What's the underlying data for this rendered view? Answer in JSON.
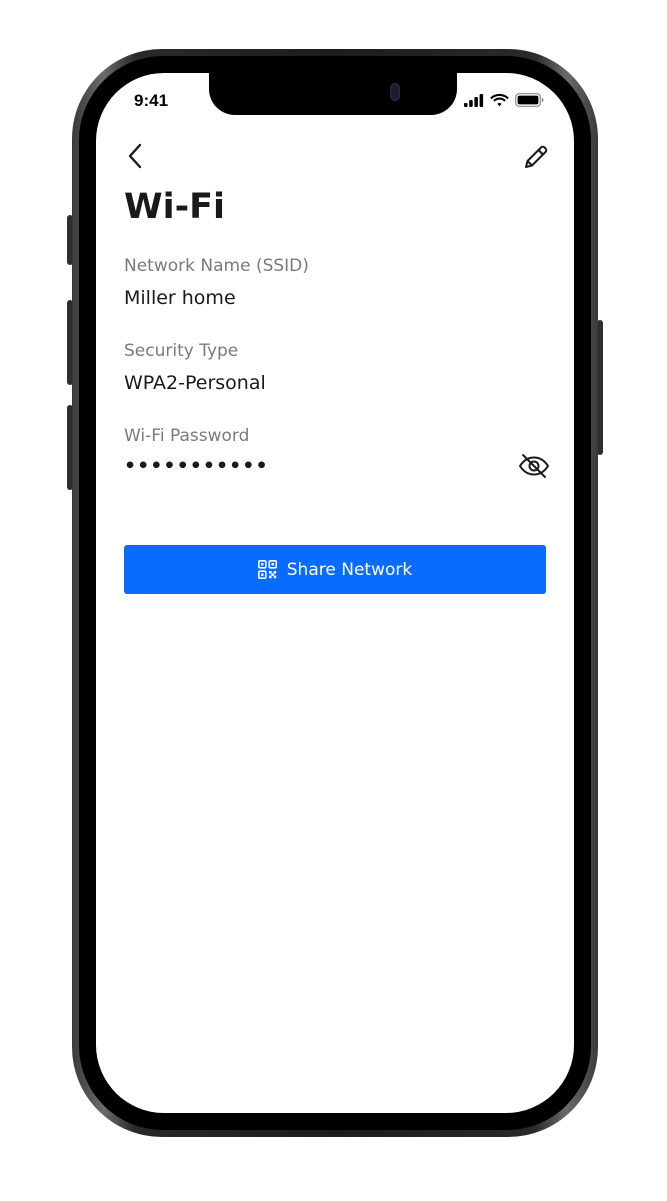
{
  "status_bar": {
    "time": "9:41",
    "icons": [
      "cellular-signal-icon",
      "wifi-icon",
      "battery-icon"
    ]
  },
  "nav": {
    "back_icon": "chevron-left-icon",
    "edit_icon": "pencil-icon"
  },
  "page": {
    "title": "Wi-Fi"
  },
  "fields": {
    "ssid": {
      "label": "Network Name (SSID)",
      "value": "Miller home"
    },
    "security": {
      "label": "Security Type",
      "value": "WPA2-Personal"
    },
    "password": {
      "label": "Wi-Fi Password",
      "value": "•••••••••••",
      "toggle_icon": "eye-off-icon"
    }
  },
  "actions": {
    "share_label": "Share Network",
    "share_icon": "qr-code-icon"
  },
  "colors": {
    "accent": "#0a6cff",
    "label": "#7a7a7a",
    "text": "#1a1a1a",
    "background": "#ffffff"
  }
}
